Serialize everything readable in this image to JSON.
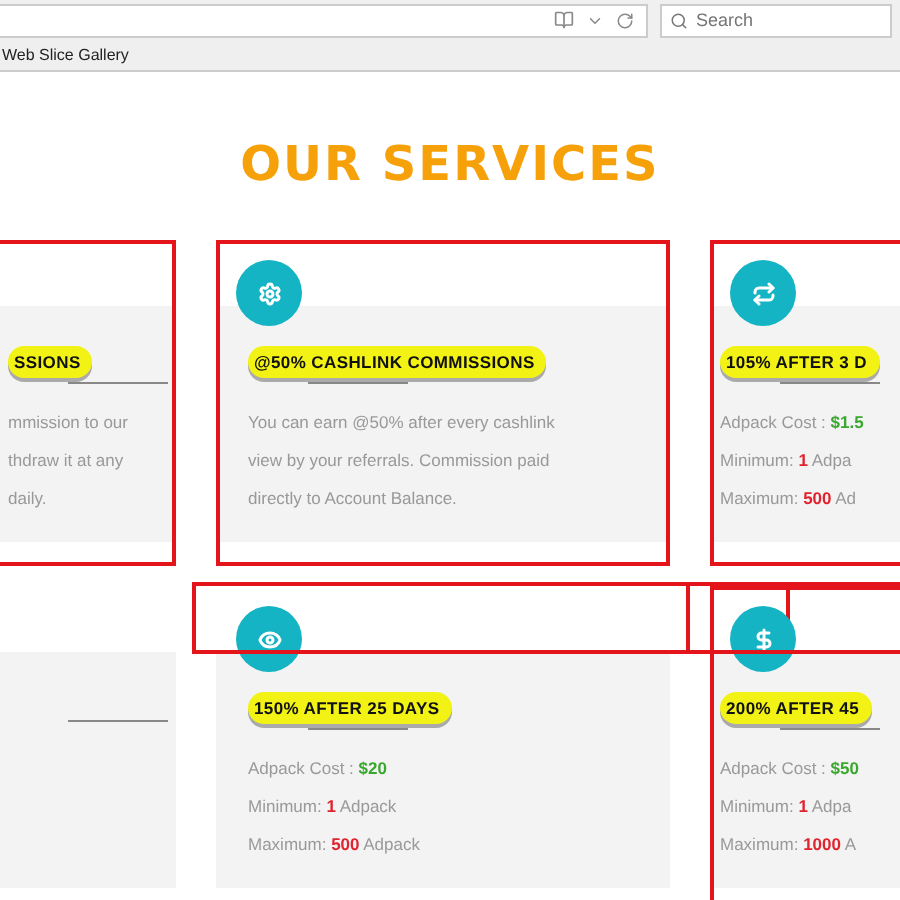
{
  "browser": {
    "search_placeholder": "Search",
    "bookmark": "Web Slice Gallery"
  },
  "heading": "OUR SERVICES",
  "cards": [
    {
      "has_icon": false,
      "framed": true,
      "header_framed": false,
      "title": "SSIONS",
      "lines": [
        {
          "parts": [
            {
              "kind": "plain",
              "text": "mmission to our"
            }
          ]
        },
        {
          "parts": [
            {
              "kind": "plain",
              "text": "thdraw it at any"
            }
          ]
        },
        {
          "parts": [
            {
              "kind": "plain",
              "text": "daily."
            }
          ]
        }
      ]
    },
    {
      "has_icon": true,
      "framed": true,
      "header_framed": false,
      "title": "@50% CASHLINK COMMISSIONS",
      "lines": [
        {
          "parts": [
            {
              "kind": "plain",
              "text": "You can earn @50% after every cashlink"
            }
          ]
        },
        {
          "parts": [
            {
              "kind": "plain",
              "text": "view by your referrals. Commission paid"
            }
          ]
        },
        {
          "parts": [
            {
              "kind": "plain",
              "text": "directly to Account Balance."
            }
          ]
        }
      ]
    },
    {
      "has_icon": true,
      "framed": true,
      "header_framed": false,
      "title": "105% AFTER 3 D",
      "lines": [
        {
          "parts": [
            {
              "kind": "plain",
              "text": "Adpack Cost : "
            },
            {
              "kind": "price",
              "text": "$1.5"
            }
          ]
        },
        {
          "parts": [
            {
              "kind": "plain",
              "text": "Minimum: "
            },
            {
              "kind": "count",
              "text": "1"
            },
            {
              "kind": "plain",
              "text": " Adpa"
            }
          ]
        },
        {
          "parts": [
            {
              "kind": "plain",
              "text": "Maximum: "
            },
            {
              "kind": "count",
              "text": "500"
            },
            {
              "kind": "plain",
              "text": " Ad"
            }
          ]
        }
      ]
    },
    {
      "has_icon": false,
      "framed": false,
      "header_framed": false
    },
    {
      "has_icon": true,
      "framed": false,
      "header_framed": true,
      "title": "150% AFTER 25 DAYS",
      "lines": [
        {
          "parts": [
            {
              "kind": "plain",
              "text": "Adpack Cost : "
            },
            {
              "kind": "price",
              "text": "$20"
            }
          ]
        },
        {
          "parts": [
            {
              "kind": "plain",
              "text": "Minimum: "
            },
            {
              "kind": "count",
              "text": "1"
            },
            {
              "kind": "plain",
              "text": " Adpack"
            }
          ]
        },
        {
          "parts": [
            {
              "kind": "plain",
              "text": "Maximum: "
            },
            {
              "kind": "count",
              "text": "500"
            },
            {
              "kind": "plain",
              "text": " Adpack"
            }
          ]
        }
      ]
    },
    {
      "has_icon": true,
      "framed": true,
      "header_framed": true,
      "title": "200% AFTER 45",
      "lines": [
        {
          "parts": [
            {
              "kind": "plain",
              "text": "Adpack Cost : "
            },
            {
              "kind": "price",
              "text": "$50"
            }
          ]
        },
        {
          "parts": [
            {
              "kind": "plain",
              "text": "Minimum: "
            },
            {
              "kind": "count",
              "text": "1"
            },
            {
              "kind": "plain",
              "text": " Adpa"
            }
          ]
        },
        {
          "parts": [
            {
              "kind": "plain",
              "text": "Maximum: "
            },
            {
              "kind": "count",
              "text": "1000"
            },
            {
              "kind": "plain",
              "text": " A"
            }
          ]
        }
      ]
    }
  ]
}
